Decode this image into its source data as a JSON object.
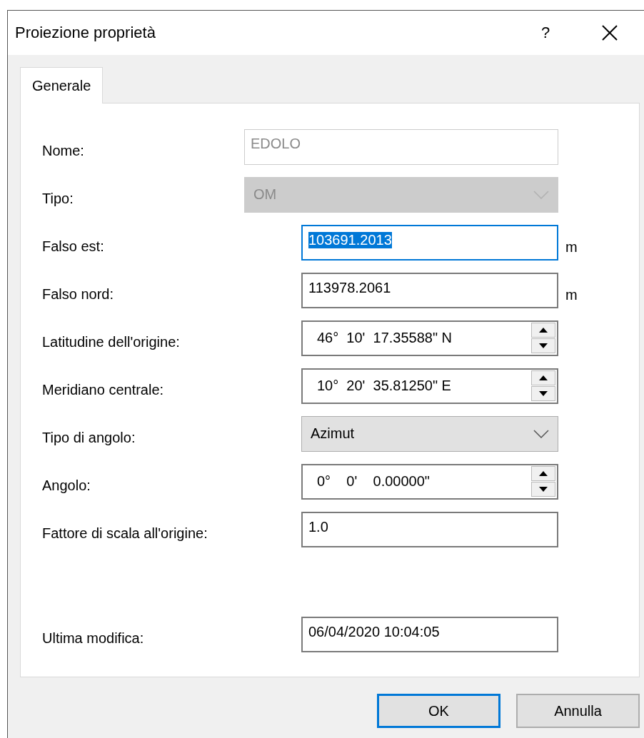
{
  "window": {
    "title": "Proiezione proprietà",
    "help": "?"
  },
  "tabs": [
    {
      "label": "Generale",
      "selected": true
    }
  ],
  "fields": [
    {
      "label": "Nome:",
      "kind": "text",
      "value": "EDOLO",
      "disabled": true,
      "text_selected": false
    },
    {
      "label": "Tipo:",
      "kind": "select",
      "value": "OM",
      "disabled": true
    },
    {
      "label": "Falso est:",
      "kind": "text",
      "value": "103691.2013",
      "unit": "m",
      "disabled": false,
      "text_selected": true
    },
    {
      "label": "Falso nord:",
      "kind": "text",
      "value": "113978.2061",
      "unit": "m",
      "disabled": false,
      "text_selected": false
    },
    {
      "label": "Latitudine dell'origine:",
      "kind": "spin",
      "value": "46°  10'  17.35588\" N",
      "disabled": false
    },
    {
      "label": "Meridiano centrale:",
      "kind": "spin",
      "value": "10°  20'  35.81250\" E",
      "disabled": false
    },
    {
      "label": "Tipo di angolo:",
      "kind": "select",
      "value": "Azimut",
      "disabled": false
    },
    {
      "label": "Angolo:",
      "kind": "spin",
      "value": "0°    0'    0.00000\"",
      "disabled": false
    },
    {
      "label": "Fattore di scala all'origine:",
      "kind": "text",
      "value": "1.0",
      "disabled": false,
      "text_selected": false
    },
    {
      "label": "Ultima modifica:",
      "kind": "text",
      "value": "06/04/2020 10:04:05",
      "disabled": false,
      "text_selected": false
    }
  ],
  "buttons": [
    {
      "label": "OK",
      "default": true
    },
    {
      "label": "Annulla",
      "default": false
    }
  ]
}
